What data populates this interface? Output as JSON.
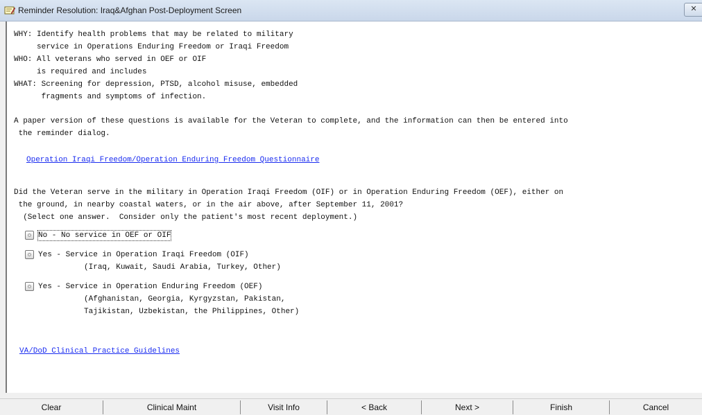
{
  "window": {
    "title": "Reminder Resolution: Iraq&Afghan Post-Deployment Screen",
    "icons": {
      "app": "reminder-pencil-icon",
      "close": "close-icon"
    },
    "close_glyph": "✕"
  },
  "content": {
    "lines": [
      "WHY: Identify health problems that may be related to military",
      "     service in Operations Enduring Freedom or Iraqi Freedom",
      "WHO: All veterans who served in OEF or OIF",
      "     is required and includes",
      "WHAT: Screening for depression, PTSD, alcohol misuse, embedded",
      "      fragments and symptoms of infection.",
      "A paper version of these questions is available for the Veteran to complete, and the information can then be entered into",
      " the reminder dialog."
    ],
    "link_questionnaire": "Operation Iraqi Freedom/Operation Enduring Freedom Questionnaire",
    "question": [
      "Did the Veteran serve in the military in Operation Iraqi Freedom (OIF) or in Operation Enduring Freedom (OEF), either on",
      " the ground, in nearby coastal waters, or in the air above, after September 11, 2001?",
      "  (Select one answer.  Consider only the patient's most recent deployment.)"
    ],
    "options": [
      {
        "line1": "No - No service in OEF or OIF"
      },
      {
        "line1": "Yes - Service in Operation Iraqi Freedom (OIF)",
        "line2": "          (Iraq, Kuwait, Saudi Arabia, Turkey, Other)"
      },
      {
        "line1": "Yes - Service in Operation Enduring Freedom (OEF)",
        "line2": "          (Afghanistan, Georgia, Kyrgyzstan, Pakistan,",
        "line3": "          Tajikistan, Uzbekistan, the Philippines, Other)"
      }
    ],
    "link_guidelines": "VA/DoD Clinical Practice Guidelines"
  },
  "buttons": {
    "clear": "Clear",
    "clinical_maint": "Clinical Maint",
    "visit_info": "Visit Info",
    "back": "< Back",
    "next": "Next >",
    "finish": "Finish",
    "cancel": "Cancel"
  },
  "colors": {
    "link": "#1a2cf0",
    "titlebar": "#c9d7ea"
  }
}
